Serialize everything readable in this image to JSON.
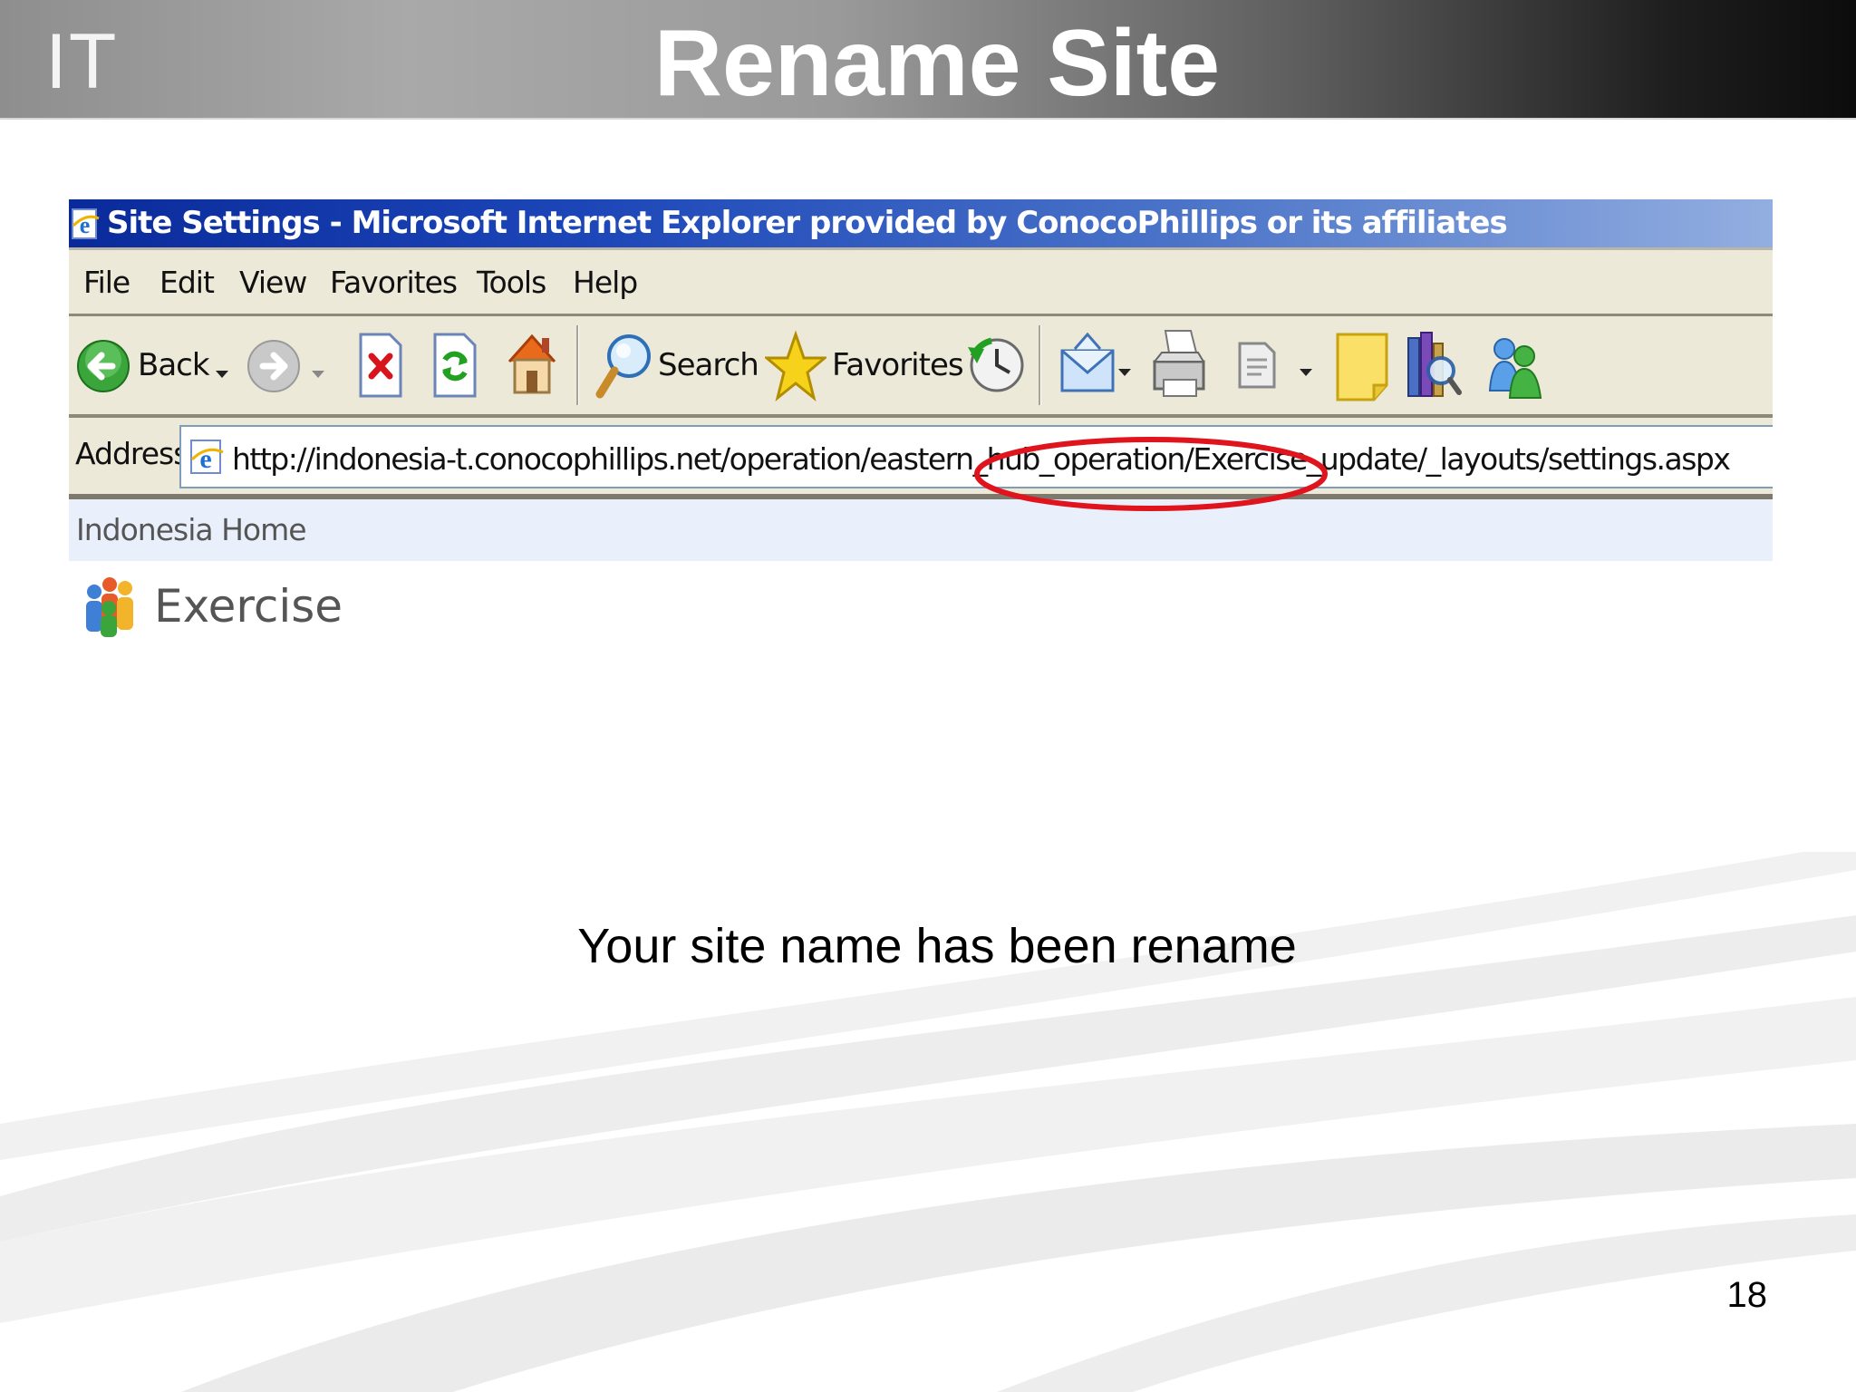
{
  "slide": {
    "logo": "IT",
    "title": "Rename Site",
    "message": "Your site name has been rename",
    "page_number": "18"
  },
  "browser": {
    "window_title": "Site Settings - Microsoft Internet Explorer provided by ConocoPhillips or its affiliates",
    "menu": [
      "File",
      "Edit",
      "View",
      "Favorites",
      "Tools",
      "Help"
    ],
    "toolbar": {
      "back_label": "Back",
      "search_label": "Search",
      "favorites_label": "Favorites"
    },
    "address": {
      "label": "Address",
      "url": "http://indonesia-t.conocophillips.net/operation/eastern_hub_operation/Exercise_update/_layouts/settings.aspx",
      "highlighted_segment": "Exercise_update"
    },
    "page": {
      "home_link": "Indonesia Home",
      "site_name": "Exercise"
    }
  },
  "colors": {
    "titlebar": "#1c46b8",
    "chrome": "#ece9d8",
    "highlight_ellipse": "#e0141c"
  }
}
